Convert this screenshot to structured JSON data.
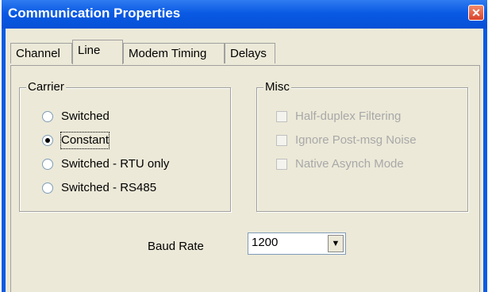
{
  "window": {
    "title": "Communication Properties",
    "close_glyph": "✕"
  },
  "tabs": [
    {
      "label": "Channel",
      "active": false
    },
    {
      "label": "Line",
      "active": true
    },
    {
      "label": "Modem Timing",
      "active": false
    },
    {
      "label": "Delays",
      "active": false
    }
  ],
  "carrier": {
    "label": "Carrier",
    "options": [
      {
        "label": "Switched",
        "selected": false
      },
      {
        "label": "Constant",
        "selected": true
      },
      {
        "label": "Switched - RTU only",
        "selected": false
      },
      {
        "label": "Switched - RS485",
        "selected": false
      }
    ]
  },
  "misc": {
    "label": "Misc",
    "options": [
      {
        "label": "Half-duplex Filtering",
        "checked": false,
        "enabled": false
      },
      {
        "label": "Ignore Post-msg Noise",
        "checked": false,
        "enabled": false
      },
      {
        "label": "Native Asynch Mode",
        "checked": false,
        "enabled": false
      }
    ]
  },
  "baud_rate": {
    "label": "Baud Rate",
    "value": "1200",
    "arrow_glyph": "▼"
  },
  "colors": {
    "title_bar": "#0a5ae4",
    "dialog_bg": "#ece9d8",
    "close_button": "#d9432b"
  }
}
